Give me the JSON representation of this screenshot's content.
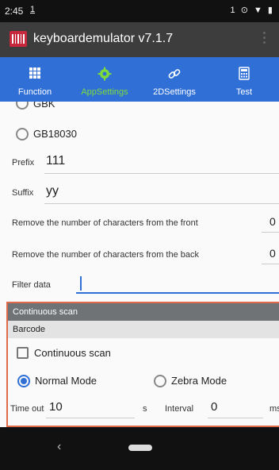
{
  "status_bar": {
    "time": "2:45",
    "notif": "1",
    "right": "1 ⊙ ▼ ▮"
  },
  "app_bar": {
    "title": "keyboardemulator v7.1.7"
  },
  "tabs": [
    {
      "label": "Function",
      "icon": "grid-icon"
    },
    {
      "label": "AppSettings",
      "icon": "settings-gear-icon",
      "active": true
    },
    {
      "label": "2DSettings",
      "icon": "link-icon"
    },
    {
      "label": "Test",
      "icon": "calculator-icon"
    }
  ],
  "encoding": {
    "option_gbk": "GBK",
    "option_gb18030": "GB18030"
  },
  "prefix": {
    "label": "Prefix",
    "value": "111"
  },
  "suffix": {
    "label": "Suffix",
    "value": "yy"
  },
  "remove_front": {
    "label": "Remove the number of characters from the front",
    "value": "0"
  },
  "remove_back": {
    "label": "Remove the number of characters from the back",
    "value": "0"
  },
  "filter": {
    "label": "Filter data",
    "value": ""
  },
  "continuous_panel": {
    "header": "Continuous scan",
    "subheader": "Barcode",
    "checkbox_label": "Continuous scan",
    "normal_mode": "Normal Mode",
    "zebra_mode": "Zebra Mode",
    "timeout_label": "Time out",
    "timeout_value": "10",
    "timeout_unit": "s",
    "interval_label": "Interval",
    "interval_value": "0",
    "interval_unit": "ms"
  },
  "colors": {
    "tab_bar": "#2f6fd6",
    "active_tab": "#7ddc3a",
    "panel_border": "#e06b4a"
  }
}
